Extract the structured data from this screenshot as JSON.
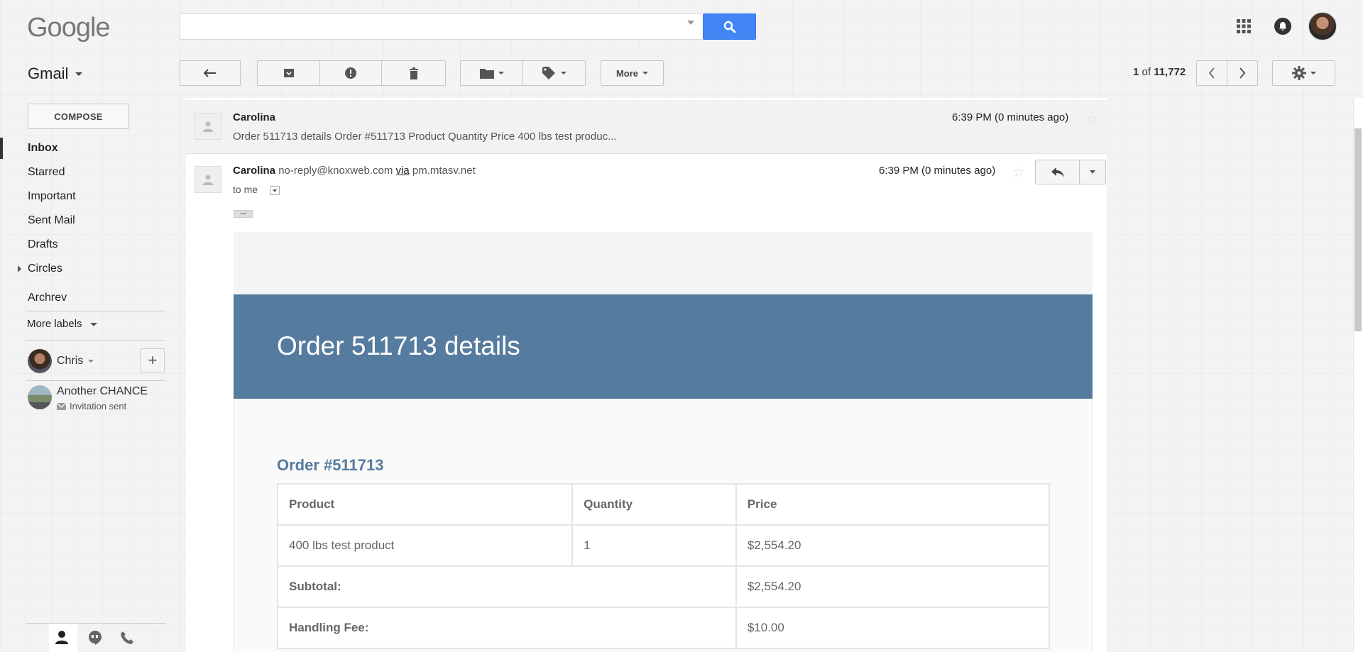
{
  "header": {
    "logo": "Google",
    "search_value": ""
  },
  "toolbar": {
    "app_label": "Gmail",
    "more_label": "More",
    "page_current": "1",
    "page_of": "of",
    "page_total": "11,772"
  },
  "sidebar": {
    "compose_label": "COMPOSE",
    "items": [
      {
        "label": "Inbox",
        "active": true
      },
      {
        "label": "Starred"
      },
      {
        "label": "Important"
      },
      {
        "label": "Sent Mail"
      },
      {
        "label": "Drafts"
      },
      {
        "label": "Circles"
      },
      {
        "label": "Archrev"
      }
    ],
    "more_labels": "More labels",
    "chat": {
      "user_name": "Chris",
      "contacts": [
        {
          "name": "Another CHANCE",
          "status": "Invitation sent"
        }
      ]
    }
  },
  "thread": {
    "collapsed": {
      "sender": "Carolina",
      "snippet": "Order 511713 details Order #511713 Product Quantity Price 400 lbs test produc...",
      "time": "6:39 PM (0 minutes ago)"
    },
    "expanded": {
      "sender": "Carolina",
      "email": "no-reply@knoxweb.com",
      "via": "via",
      "via_domain": "pm.mtasv.net",
      "to": "to me",
      "time": "6:39 PM (0 minutes ago)",
      "ellipsis": "..."
    }
  },
  "email": {
    "banner_title": "Order 511713 details",
    "order_heading": "Order #511713",
    "table": {
      "headers": [
        "Product",
        "Quantity",
        "Price"
      ],
      "product": "400 lbs test product",
      "quantity": "1",
      "price": "$2,554.20",
      "subtotal_label": "Subtotal:",
      "subtotal_value": "$2,554.20",
      "handling_label": "Handling Fee:",
      "handling_value": "$10.00"
    }
  },
  "colors": {
    "accent_blue": "#4285f4",
    "banner": "#557b9f"
  }
}
